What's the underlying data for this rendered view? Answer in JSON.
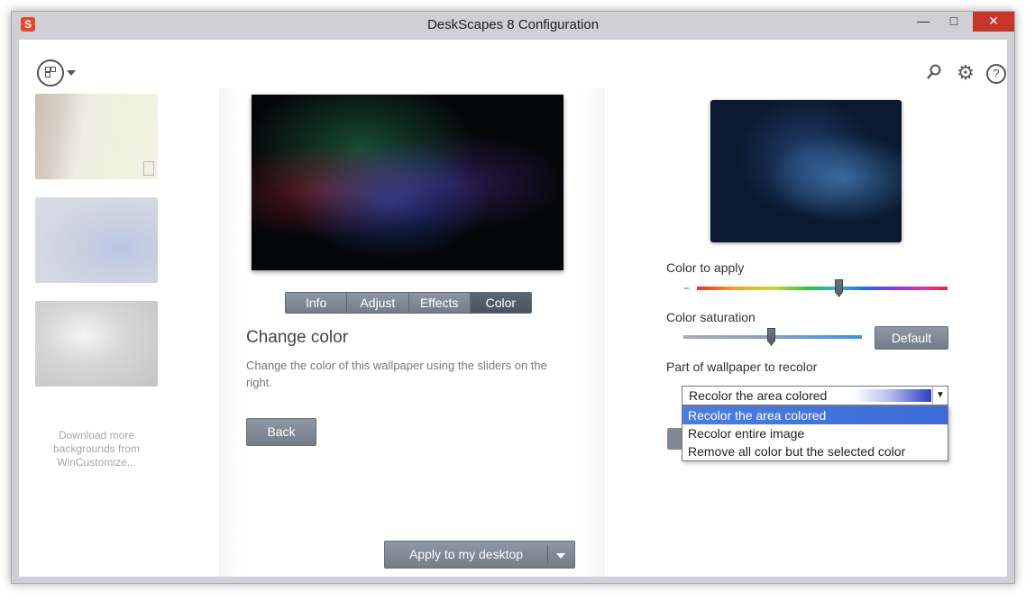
{
  "window": {
    "title": "DeskScapes 8 Configuration",
    "app_icon": "S",
    "controls": {
      "minimize": "—",
      "maximize": "□",
      "close": "✕"
    }
  },
  "sidebar": {
    "view_icon": "view-layout-icon",
    "download_text": "Download more backgrounds from WinCustomize..."
  },
  "tabs": [
    {
      "label": "Info"
    },
    {
      "label": "Adjust"
    },
    {
      "label": "Effects"
    },
    {
      "label": "Color",
      "active": true
    }
  ],
  "content": {
    "title": "Change color",
    "description": "Change the color of this wallpaper using the sliders on the right.",
    "back_label": "Back",
    "apply_label": "Apply to my desktop"
  },
  "toolbar": {
    "search_icon": "search-icon",
    "settings_icon": "gear-icon",
    "help_icon": "help-icon",
    "help_glyph": "?"
  },
  "color_panel": {
    "color_label": "Color to apply",
    "color_value": 0.57,
    "saturation_label": "Color saturation",
    "saturation_value": 0.5,
    "default_label": "Default",
    "recolor_label": "Part of wallpaper to recolor",
    "selected": "Recolor the area colored",
    "options": [
      "Recolor the area colored",
      "Recolor entire image",
      "Remove all color but the selected color"
    ]
  },
  "colors": {
    "button": "#7d8792",
    "active_tab": "#525c69",
    "dropdown_highlight": "#3f70da",
    "close_button": "#c7352b"
  }
}
